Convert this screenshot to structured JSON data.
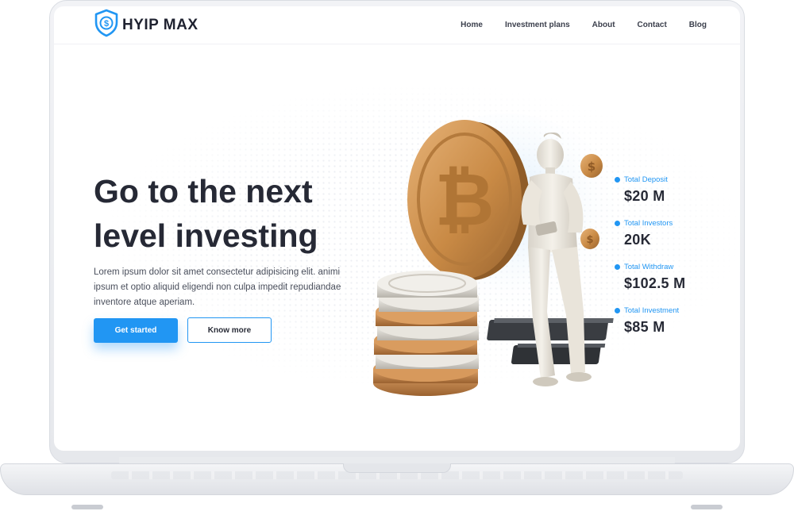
{
  "brand": {
    "name": "HYIP MAX",
    "accent": "#2196f3"
  },
  "nav": [
    {
      "label": "Home"
    },
    {
      "label": "Investment plans"
    },
    {
      "label": "About"
    },
    {
      "label": "Contact"
    },
    {
      "label": "Blog"
    }
  ],
  "hero": {
    "title_line1": "Go to the next",
    "title_line2": "level investing",
    "description": "Lorem ipsum dolor sit amet consectetur adipisicing elit. animi ipsum et optio aliquid eligendi non culpa impedit repudiandae inventore atque aperiam.",
    "primary_button": "Get started",
    "secondary_button": "Know more"
  },
  "stats": [
    {
      "label": "Total Deposit",
      "value": "$20 M"
    },
    {
      "label": "Total Investors",
      "value": "20K"
    },
    {
      "label": "Total Withdraw",
      "value": "$102.5 M"
    },
    {
      "label": "Total Investment",
      "value": "$85 M"
    }
  ],
  "icons": {
    "logo": "shield-dollar-icon",
    "stat_marker": "dot-icon"
  },
  "colors": {
    "text_dark": "#262935",
    "coin_gold": "#c98a45",
    "coin_silver": "#d9d6cf"
  }
}
